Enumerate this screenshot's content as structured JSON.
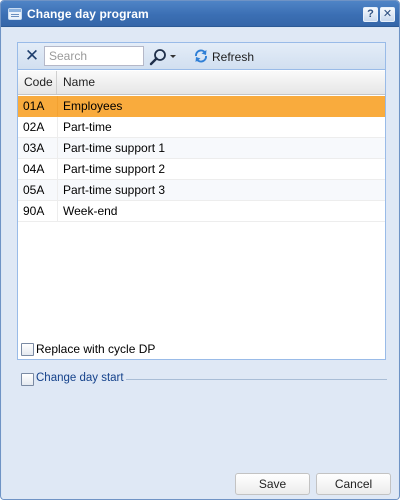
{
  "window": {
    "title": "Change day program",
    "help_symbol": "?",
    "close_symbol": "✕"
  },
  "toolbar": {
    "search_placeholder": "Search",
    "search_value": "",
    "refresh_label": "Refresh"
  },
  "grid": {
    "columns": {
      "code": "Code",
      "name": "Name"
    },
    "rows": [
      {
        "code": "01A",
        "name": "Employees",
        "selected": true
      },
      {
        "code": "02A",
        "name": "Part-time"
      },
      {
        "code": "03A",
        "name": "Part-time support 1"
      },
      {
        "code": "04A",
        "name": "Part-time support 2"
      },
      {
        "code": "05A",
        "name": "Part-time support 3"
      },
      {
        "code": "90A",
        "name": "Week-end"
      }
    ]
  },
  "options": {
    "replace_label": "Replace with cycle DP",
    "replace_checked": false,
    "change_day_start_label": "Change day start",
    "change_day_start_checked": false
  },
  "footer": {
    "save_label": "Save",
    "cancel_label": "Cancel"
  },
  "colors": {
    "title_bar": "#3b6fb4",
    "selected_row": "#f9ab3d",
    "panel_border": "#99bbe8"
  }
}
